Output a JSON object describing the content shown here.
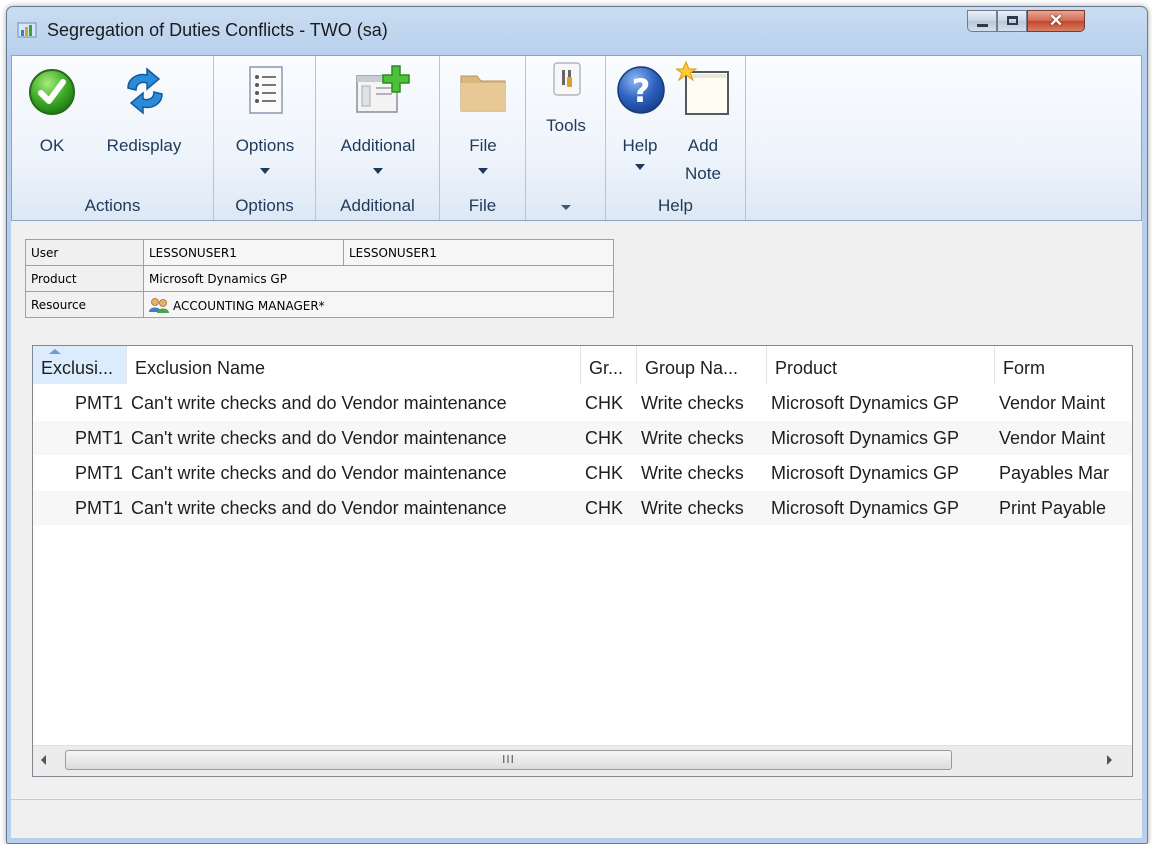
{
  "window": {
    "title": "Segregation of Duties Conflicts  -  TWO (sa)"
  },
  "ribbon": {
    "groups": [
      {
        "label": "Actions",
        "buttons": [
          {
            "label": "OK",
            "icon": "ok-check-icon"
          },
          {
            "label": "Redisplay",
            "icon": "refresh-icon"
          }
        ]
      },
      {
        "label": "Options",
        "buttons": [
          {
            "label": "Options",
            "icon": "list-document-icon"
          }
        ]
      },
      {
        "label": "Additional",
        "buttons": [
          {
            "label": "Additional",
            "icon": "window-add-icon"
          }
        ]
      },
      {
        "label": "File",
        "buttons": [
          {
            "label": "File",
            "icon": "folder-icon"
          }
        ]
      },
      {
        "label": "",
        "buttons": [
          {
            "label": "Tools",
            "icon": "tools-icon"
          }
        ]
      },
      {
        "label": "Help",
        "buttons": [
          {
            "label": "Help",
            "icon": "help-icon"
          },
          {
            "label": "Add",
            "label2": "Note",
            "icon": "note-icon"
          }
        ]
      }
    ]
  },
  "info": {
    "user_label": "User",
    "user_id": "LESSONUSER1",
    "user_name": "LESSONUSER1",
    "product_label": "Product",
    "product_value": "Microsoft Dynamics GP",
    "resource_label": "Resource",
    "resource_value": "ACCOUNTING MANAGER*"
  },
  "grid": {
    "columns": [
      "Exclusi...",
      "Exclusion Name",
      "Gr...",
      "Group Na...",
      "Product",
      "Form"
    ],
    "rows": [
      [
        "PMT1",
        "Can't write checks and do Vendor maintenance",
        "CHK",
        "Write checks",
        "Microsoft Dynamics GP",
        "Vendor Maint"
      ],
      [
        "PMT1",
        "Can't write checks and do Vendor maintenance",
        "CHK",
        "Write checks",
        "Microsoft Dynamics GP",
        "Vendor Maint"
      ],
      [
        "PMT1",
        "Can't write checks and do Vendor maintenance",
        "CHK",
        "Write checks",
        "Microsoft Dynamics GP",
        "Payables Mar"
      ],
      [
        "PMT1",
        "Can't write checks and do Vendor maintenance",
        "CHK",
        "Write checks",
        "Microsoft Dynamics GP",
        "Print Payable"
      ]
    ],
    "scroll_grip": "III"
  }
}
